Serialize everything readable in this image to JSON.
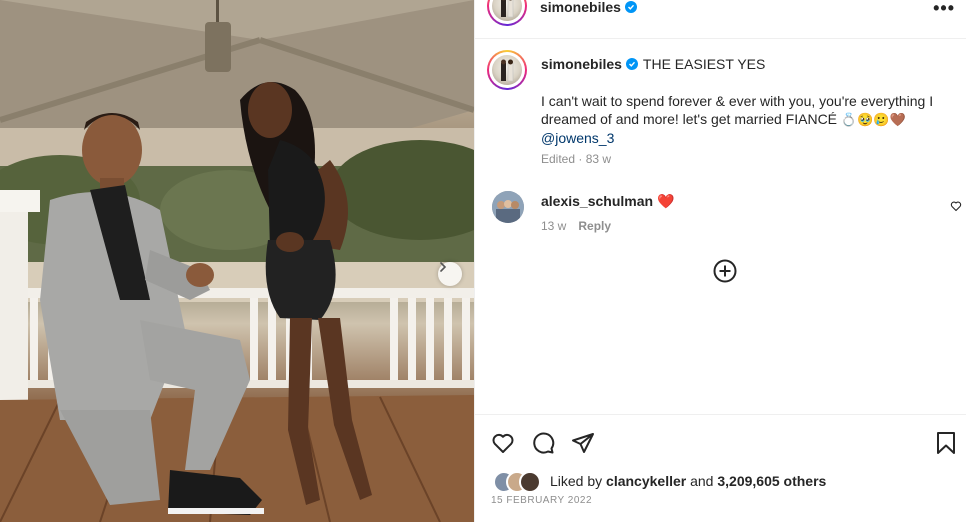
{
  "post": {
    "username": "simonebiles",
    "more_label": "•••",
    "caption_title": "THE EASIEST YES",
    "caption_body": "I can't wait to spend forever & ever with you, you're everything I dreamed of and more! let's get married FIANCÉ",
    "caption_emojis": "💍🥹🥲🤎",
    "caption_mention": "@jowens_3",
    "edited_label": "Edited · 83 w"
  },
  "comment": {
    "username": "alexis_schulman",
    "emoji": "❤️",
    "age": "13 w",
    "reply_label": "Reply"
  },
  "likes": {
    "prefix": "Liked by",
    "liker": "clancykeller",
    "joiner": "and",
    "others": "3,209,605 others"
  },
  "date": "15 FEBRUARY 2022",
  "icons": [
    "verified-badge-icon",
    "more-icon",
    "heart-icon",
    "comment-icon",
    "share-icon",
    "save-icon",
    "add-circle-icon",
    "next-arrow-icon"
  ],
  "colors": {
    "verified": "#0095f6",
    "mention": "#00376b",
    "muted": "#8e8e8e",
    "divider": "#efefef"
  }
}
